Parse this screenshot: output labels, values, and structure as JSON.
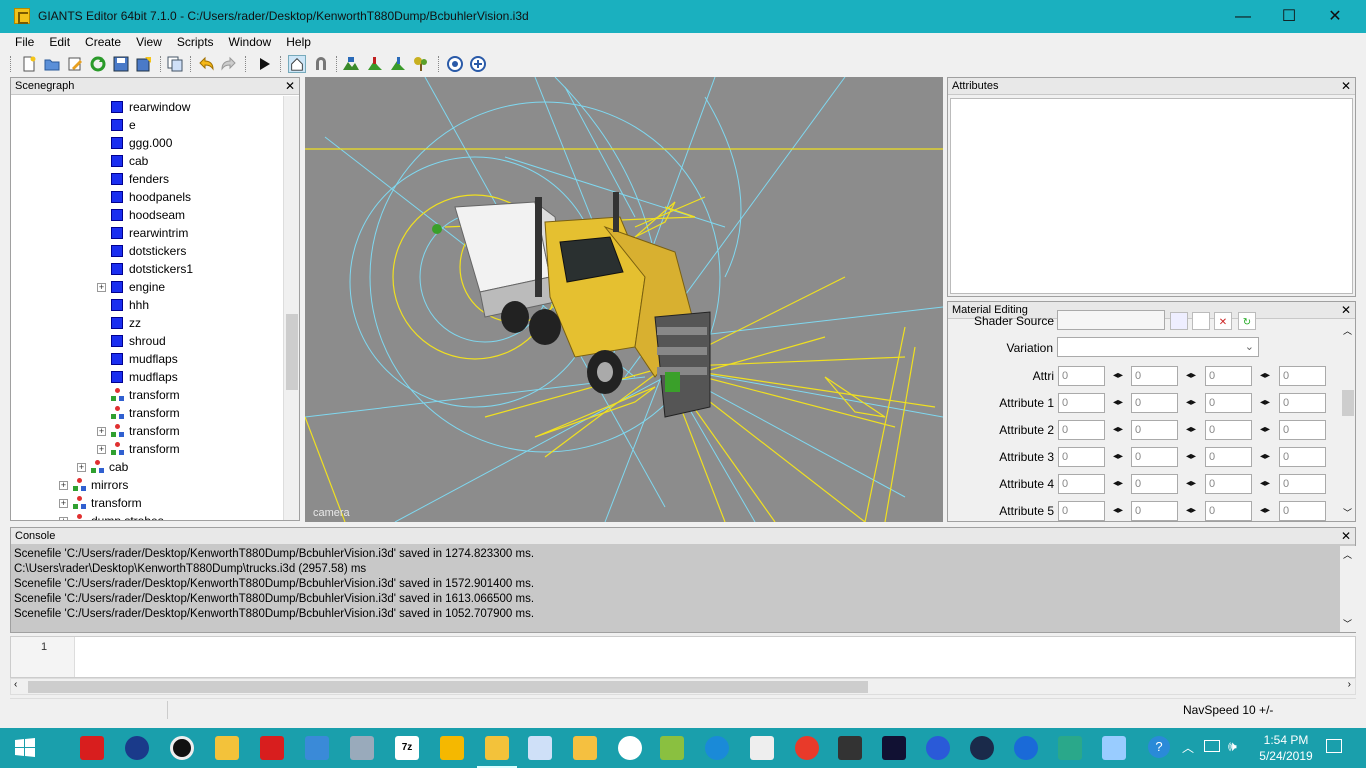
{
  "window": {
    "title": "GIANTS Editor 64bit 7.1.0 - C:/Users/rader/Desktop/KenworthT880Dump/BcbuhlerVision.i3d",
    "minimize": "—",
    "maximize": "☐",
    "close": "✕"
  },
  "menu": [
    "File",
    "Edit",
    "Create",
    "View",
    "Scripts",
    "Window",
    "Help"
  ],
  "toolbar_icons": [
    "new-file-icon",
    "open-folder-icon",
    "edit-icon",
    "refresh-icon",
    "save-icon",
    "export-icon",
    "copy-icon",
    "undo-icon",
    "redo-icon",
    "play-icon",
    "home-view-icon",
    "magnet-icon",
    "terrain-icon",
    "paint-icon",
    "foliage-icon",
    "plant-icon",
    "sync-icon",
    "settings-gear-icon"
  ],
  "scenegraph": {
    "title": "Scenegraph",
    "close": "✕",
    "nodes": [
      {
        "label": "rearwindow",
        "type": "shape",
        "expandable": false
      },
      {
        "label": "e",
        "type": "shape",
        "expandable": false
      },
      {
        "label": "ggg.000",
        "type": "shape",
        "expandable": false
      },
      {
        "label": "cab",
        "type": "shape",
        "expandable": false
      },
      {
        "label": "fenders",
        "type": "shape",
        "expandable": false
      },
      {
        "label": "hoodpanels",
        "type": "shape",
        "expandable": false
      },
      {
        "label": "hoodseam",
        "type": "shape",
        "expandable": false
      },
      {
        "label": "rearwintrim",
        "type": "shape",
        "expandable": false
      },
      {
        "label": "dotstickers",
        "type": "shape",
        "expandable": false
      },
      {
        "label": "dotstickers1",
        "type": "shape",
        "expandable": false
      },
      {
        "label": "engine",
        "type": "shape",
        "expandable": true
      },
      {
        "label": "hhh",
        "type": "shape",
        "expandable": false
      },
      {
        "label": "zz",
        "type": "shape",
        "expandable": false
      },
      {
        "label": "shroud",
        "type": "shape",
        "expandable": false
      },
      {
        "label": "mudflaps",
        "type": "shape",
        "expandable": false
      },
      {
        "label": "mudflaps",
        "type": "shape",
        "expandable": false
      },
      {
        "label": "transform",
        "type": "transform",
        "expandable": false
      },
      {
        "label": "transform",
        "type": "transform",
        "expandable": false
      },
      {
        "label": "transform",
        "type": "transform",
        "expandable": true
      },
      {
        "label": "transform",
        "type": "transform",
        "expandable": true
      },
      {
        "label": "cab",
        "type": "transform",
        "expandable": true
      },
      {
        "label": "mirrors",
        "type": "transform",
        "expandable": true
      },
      {
        "label": "transform",
        "type": "transform",
        "expandable": true
      },
      {
        "label": "dump strobes",
        "type": "transform",
        "expandable": true
      }
    ]
  },
  "viewport": {
    "camera_label": "camera"
  },
  "attributes": {
    "title": "Attributes",
    "close": "✕"
  },
  "material_editing": {
    "title": "Material Editing",
    "close": "✕",
    "shader_source_label": "Shader Source",
    "variation_label": "Variation",
    "variation_value": "",
    "rows": [
      {
        "label": "Attri",
        "values": [
          "0",
          "0",
          "0",
          "0"
        ]
      },
      {
        "label": "Attribute 1",
        "values": [
          "0",
          "0",
          "0",
          "0"
        ]
      },
      {
        "label": "Attribute 2",
        "values": [
          "0",
          "0",
          "0",
          "0"
        ]
      },
      {
        "label": "Attribute 3",
        "values": [
          "0",
          "0",
          "0",
          "0"
        ]
      },
      {
        "label": "Attribute 4",
        "values": [
          "0",
          "0",
          "0",
          "0"
        ]
      },
      {
        "label": "Attribute 5",
        "values": [
          "0",
          "0",
          "0",
          "0"
        ]
      }
    ]
  },
  "console": {
    "title": "Console",
    "close": "✕",
    "lines": [
      "Scenefile 'C:/Users/rader/Desktop/KenworthT880Dump/BcbuhlerVision.i3d' saved in 1274.823300 ms.",
      "C:\\Users\\rader\\Desktop\\KenworthT880Dump\\trucks.i3d (2957.58) ms",
      "Scenefile 'C:/Users/rader/Desktop/KenworthT880Dump/BcbuhlerVision.i3d' saved in 1572.901400 ms.",
      "Scenefile 'C:/Users/rader/Desktop/KenworthT880Dump/BcbuhlerVision.i3d' saved in 1613.066500 ms.",
      "Scenefile 'C:/Users/rader/Desktop/KenworthT880Dump/BcbuhlerVision.i3d' saved in 1052.707900 ms."
    ]
  },
  "script": {
    "line_number": "1"
  },
  "statusbar": {
    "nav_speed": "NavSpeed 10 +/-"
  },
  "taskbar": {
    "time": "1:54 PM",
    "date": "5/24/2019",
    "apps": [
      "start-icon",
      "giants-editor-icon",
      "fire-app-icon",
      "obs-icon",
      "file-explorer-icon",
      "giants-editor-2-icon",
      "control-panel-icon",
      "network-icon",
      "7zip-icon",
      "slides-icon",
      "giants-active-icon",
      "visual-studio-icon",
      "media-player-icon",
      "itunes-icon",
      "notepad-icon",
      "internet-explorer-icon",
      "calculator-icon",
      "chrome-icon",
      "sublime-icon",
      "firefox-dev-icon",
      "chrome-canary-icon",
      "steam-icon",
      "edge-icon",
      "game-icon",
      "text-editor-icon"
    ],
    "tray": [
      "help-icon",
      "chevron-up-icon",
      "network-tray-icon",
      "volume-icon",
      "notification-icon"
    ]
  },
  "colors": {
    "titlebar": "#1ab0bf",
    "taskbar": "#1a9fac",
    "viewport_bg": "#8c8c8c",
    "wire_yellow": "#f0e020",
    "wire_cyan": "#7fd8f0"
  }
}
